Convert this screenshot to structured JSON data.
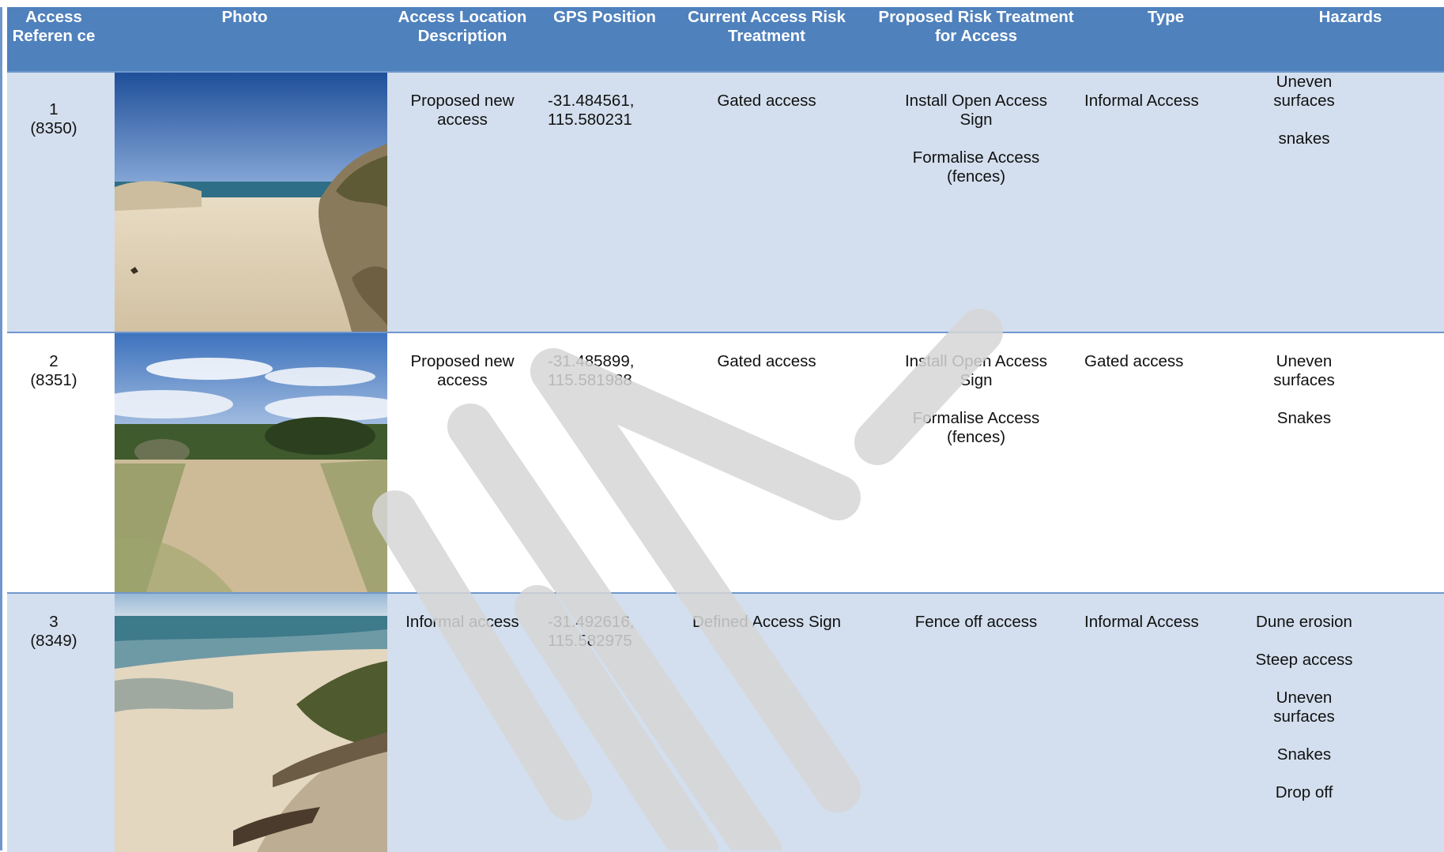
{
  "headers": {
    "ref": "Access Referen ce",
    "photo": "Photo",
    "location": "Access Location Description",
    "gps": "GPS Position",
    "current": "Current Access Risk Treatment",
    "proposed": "Proposed Risk Treatment for Access",
    "type": "Type",
    "hazards": "Hazards"
  },
  "rows": [
    {
      "ref_num": "1",
      "ref_code": "(8350)",
      "photo": "beach-dune-path-photo",
      "location": "Proposed new access",
      "gps_lat": "-31.484561,",
      "gps_lon": "115.580231",
      "current": "Gated access",
      "proposed": [
        "Install Open Access Sign",
        "Formalise Access (fences)"
      ],
      "type": "Informal Access",
      "hazards": [
        "Uneven surfaces",
        "snakes"
      ]
    },
    {
      "ref_num": "2",
      "ref_code": "(8351)",
      "photo": "vegetated-sand-track-photo",
      "location": "Proposed new access",
      "gps_lat": "-31.485899,",
      "gps_lon": "115.581988",
      "current": "Gated access",
      "proposed": [
        "Install Open Access Sign",
        "Formalise Access (fences)"
      ],
      "type": "Gated access",
      "hazards": [
        "Uneven surfaces",
        "Snakes"
      ]
    },
    {
      "ref_num": "3",
      "ref_code": "(8349)",
      "photo": "eroded-dune-shore-photo",
      "location": "Informal access",
      "gps_lat": "-31.492616,",
      "gps_lon": "115.582975",
      "current": "Defined Access Sign",
      "proposed": [
        "Fence off access"
      ],
      "type": "Informal Access",
      "hazards": [
        "Dune erosion",
        "Steep access",
        "Uneven surfaces",
        "Snakes",
        "Drop off"
      ]
    }
  ],
  "colors": {
    "header_bg": "#4f81bd",
    "row_shade": "#d3dfee",
    "border": "#6f97cc",
    "watermark": "#d6d6d6"
  }
}
